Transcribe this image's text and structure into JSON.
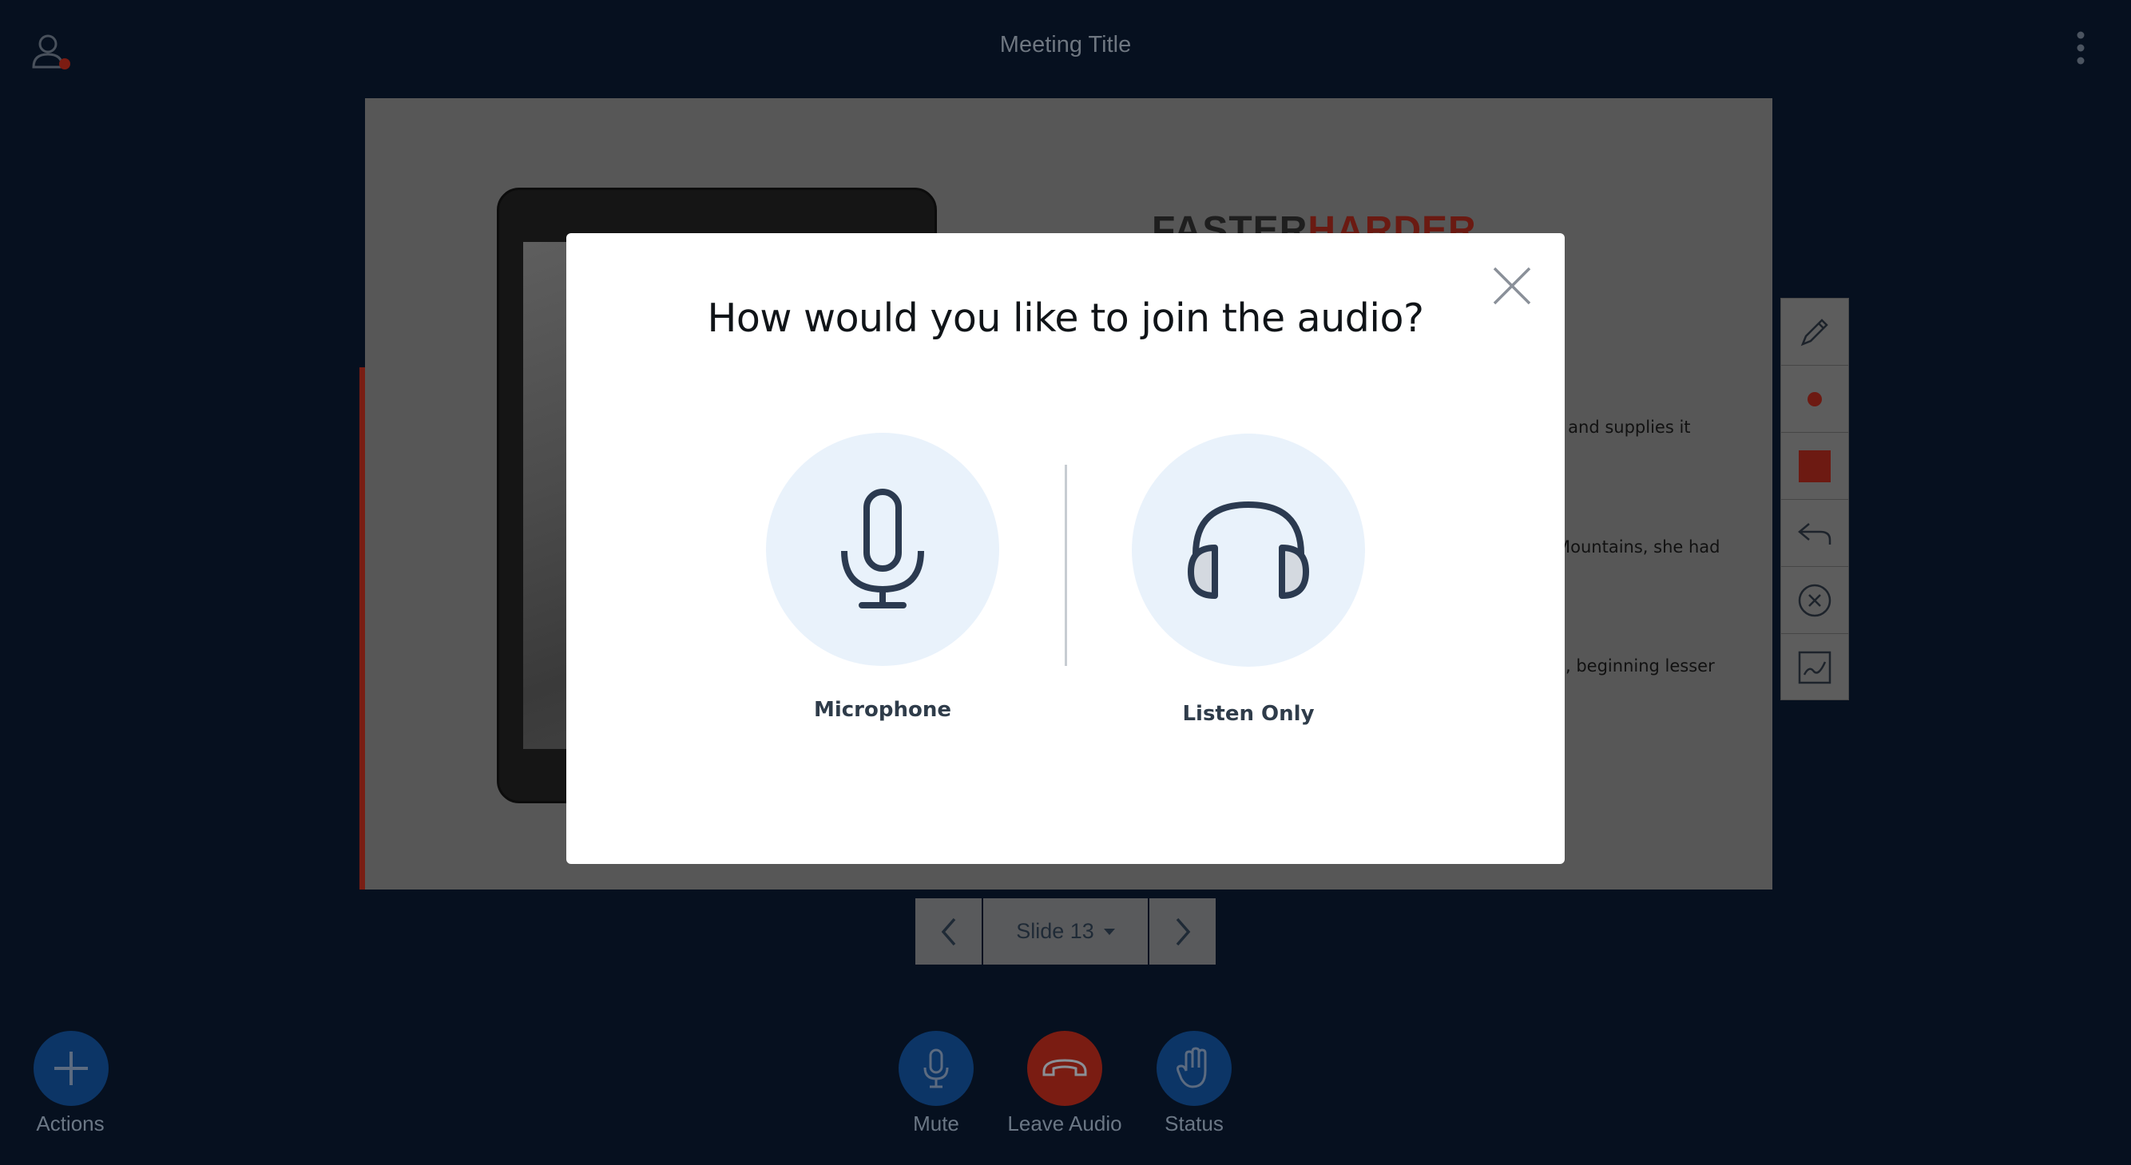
{
  "header": {
    "meeting_title": "Meeting Title",
    "user_icon": "user-icon",
    "options_icon": "kebab-menu-icon"
  },
  "slide": {
    "logo_part1": "FASTER",
    "logo_part2": "HARDER",
    "text_line1": "ce and supplies it",
    "text_line2": "Mountains, she had",
    "text_line3": ", beginning lesser"
  },
  "annotation_tools": {
    "items": [
      "pencil-icon",
      "dot-icon",
      "color-square-icon",
      "undo-icon",
      "clear-icon",
      "whiteboard-icon"
    ]
  },
  "slide_nav": {
    "current_label": "Slide 13",
    "prev_icon": "chevron-left-icon",
    "next_icon": "chevron-right-icon"
  },
  "action_bar": {
    "actions_label": "Actions",
    "mute_label": "Mute",
    "leave_audio_label": "Leave Audio",
    "status_label": "Status"
  },
  "modal": {
    "title": "How would you like to join the audio?",
    "microphone_label": "Microphone",
    "listen_only_label": "Listen Only",
    "close_icon": "close-icon"
  },
  "colors": {
    "background": "#06101f",
    "modal_background": "#ffffff",
    "option_circle": "#e9f2fb",
    "icon_stroke": "#2b3a50",
    "blue_button": "#0c3566",
    "red_button": "#7a1c12"
  }
}
